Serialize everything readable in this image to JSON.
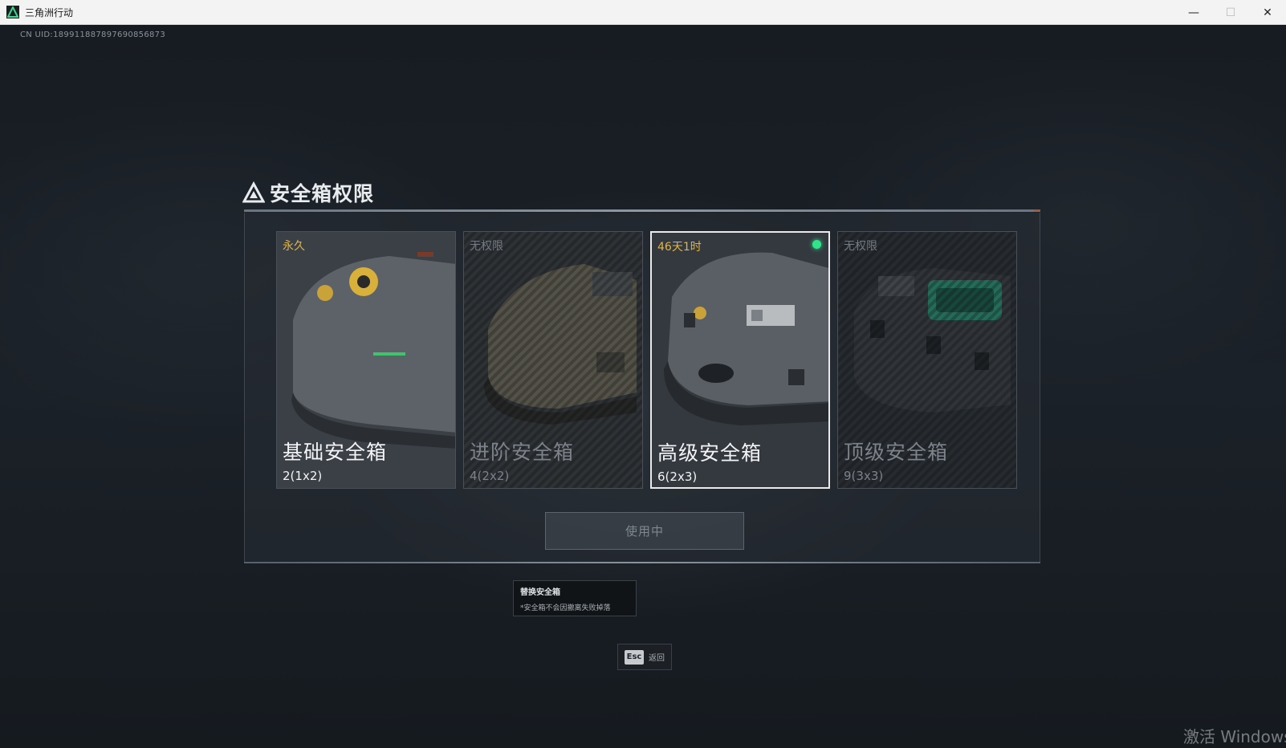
{
  "window": {
    "title": "三角洲行动",
    "minimize_glyph": "—",
    "maximize_glyph": "☐",
    "close_glyph": "✕"
  },
  "uid": "CN UID:189911887897690856873",
  "panel": {
    "title": "安全箱权限",
    "icon": "delta-triangle-icon"
  },
  "cards": [
    {
      "badge": "永久",
      "name": "基础安全箱",
      "size": "2(1x2)",
      "state": "unlocked",
      "selected": false
    },
    {
      "badge": "无权限",
      "name": "进阶安全箱",
      "size": "4(2x2)",
      "state": "locked",
      "selected": false
    },
    {
      "badge": "46天1时",
      "name": "高级安全箱",
      "size": "6(2x3)",
      "state": "unlocked",
      "selected": true
    },
    {
      "badge": "无权限",
      "name": "顶级安全箱",
      "size": "9(3x3)",
      "state": "locked",
      "selected": false
    }
  ],
  "use_button": {
    "label": "使用中"
  },
  "tooltip": {
    "title": "替换安全箱",
    "note": "*安全箱不会因撤离失败掉落"
  },
  "back": {
    "key": "Esc",
    "label": "返回"
  },
  "watermark": "激活 Windows",
  "colors": {
    "accent_gold": "#e1b447",
    "active_green": "#2fe48a",
    "locked_grey": "#747b82"
  }
}
